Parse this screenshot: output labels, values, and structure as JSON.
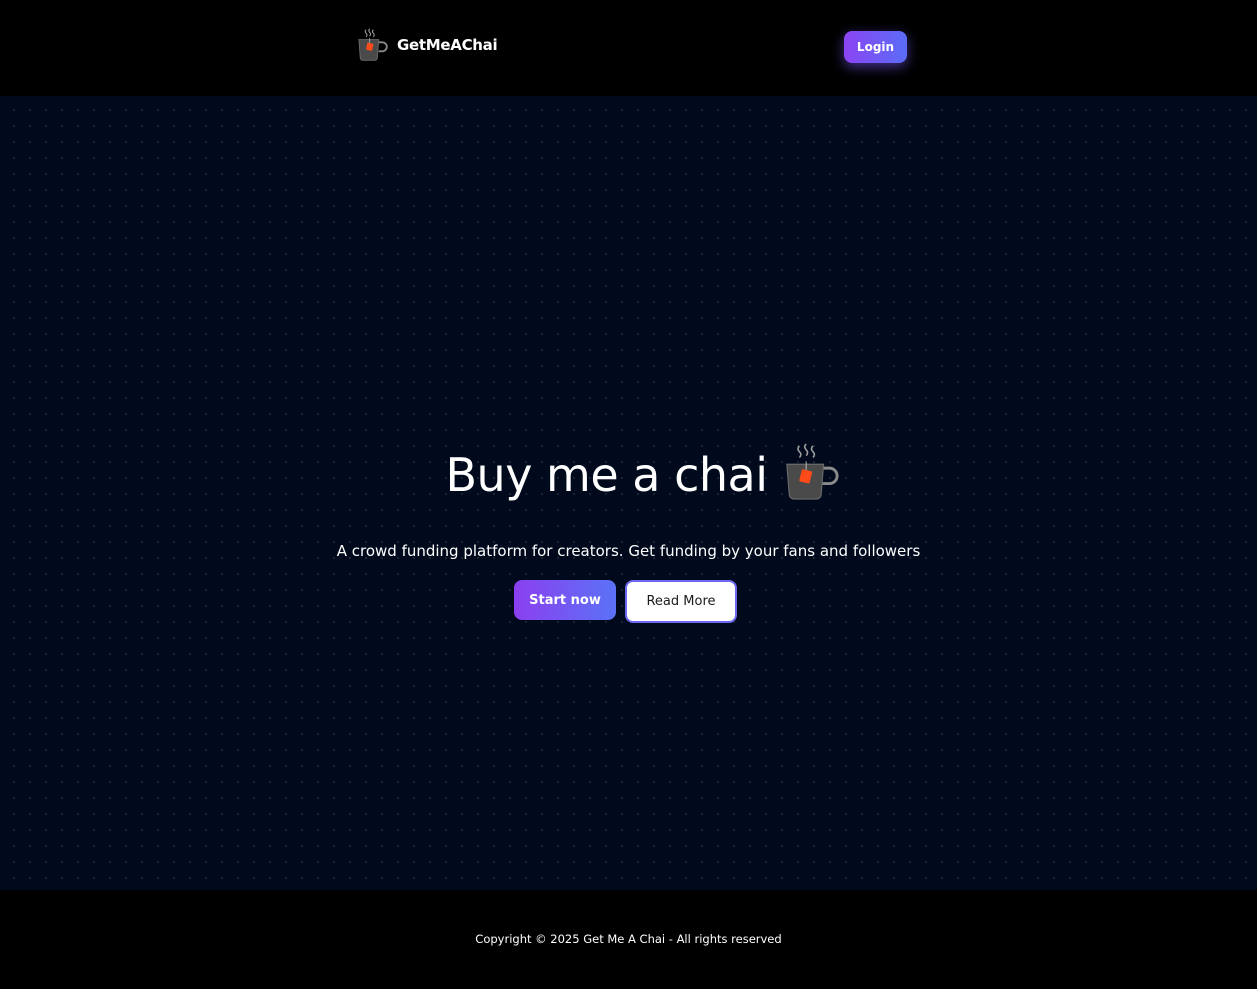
{
  "navbar": {
    "brand_name": "GetMeAChai",
    "brand_icon": "chai-mug-icon",
    "login_label": "Login"
  },
  "hero": {
    "title": "Buy me a chai",
    "title_icon": "chai-mug-icon",
    "subtitle": "A crowd funding platform for creators. Get funding by your fans and followers",
    "start_label": "Start now",
    "read_more_label": "Read More"
  },
  "footer": {
    "copyright": "Copyright © 2025 Get Me A Chai - All rights reserved"
  },
  "colors": {
    "background": "#000000",
    "hero_background": "#000a1c",
    "accent_start": "#8b3ff0",
    "accent_end": "#5b72f6",
    "read_more_border": "#6d68f2",
    "tea_bag": "#ff4a1a"
  }
}
